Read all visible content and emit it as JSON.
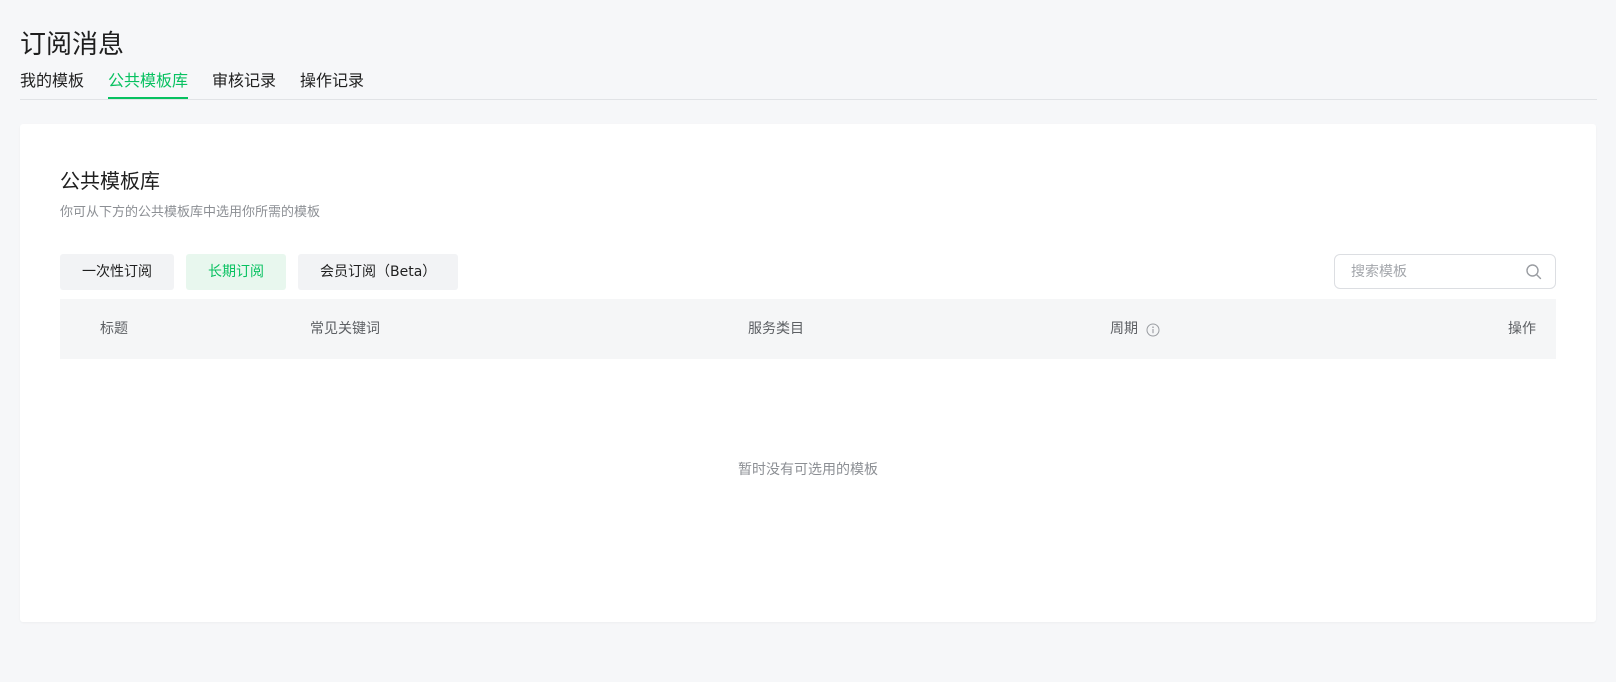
{
  "page": {
    "title": "订阅消息"
  },
  "tabs": [
    {
      "label": "我的模板",
      "active": false
    },
    {
      "label": "公共模板库",
      "active": true
    },
    {
      "label": "审核记录",
      "active": false
    },
    {
      "label": "操作记录",
      "active": false
    }
  ],
  "section": {
    "title": "公共模板库",
    "description": "你可从下方的公共模板库中选用你所需的模板"
  },
  "filters": [
    {
      "label": "一次性订阅",
      "active": false
    },
    {
      "label": "长期订阅",
      "active": true
    },
    {
      "label": "会员订阅（Beta）",
      "active": false
    }
  ],
  "search": {
    "placeholder": "搜索模板",
    "value": "",
    "icon": "search-icon"
  },
  "table": {
    "columns": [
      "标题",
      "常见关键词",
      "服务类目",
      "周期",
      "操作"
    ],
    "period_info_icon": "info-icon",
    "rows": [],
    "empty_text": "暂时没有可选用的模板"
  },
  "colors": {
    "accent": "#07c160",
    "background": "#f6f7f9",
    "card": "#ffffff",
    "header_bg": "#f5f6f7",
    "muted_text": "#8c8f94"
  }
}
